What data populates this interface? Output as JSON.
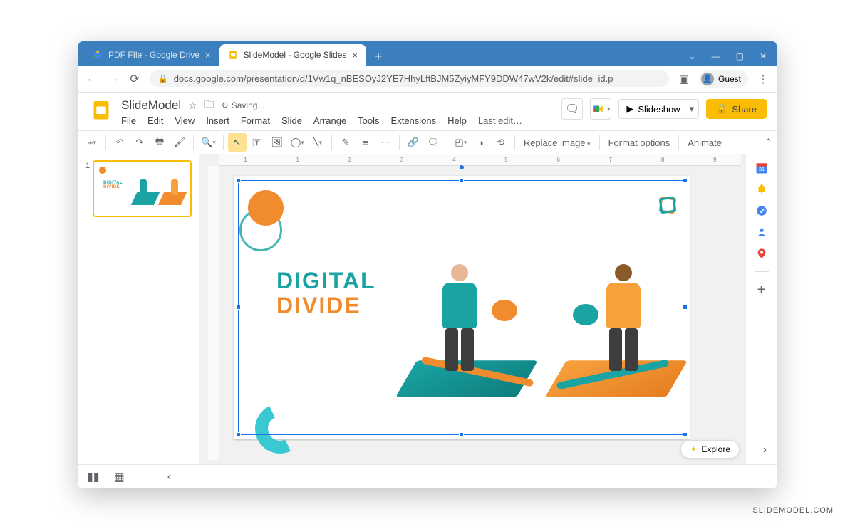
{
  "browser": {
    "tabs": [
      {
        "title": "PDF FIle - Google Drive",
        "active": false
      },
      {
        "title": "SlideModel - Google Slides",
        "active": true
      }
    ],
    "url": "docs.google.com/presentation/d/1Vw1q_nBESOyJ2YE7HhyLftBJM5ZyiyMFY9DDW47wV2k/edit#slide=id.p",
    "guest_label": "Guest"
  },
  "doc": {
    "title": "SlideModel",
    "saving": "Saving...",
    "last_edit": "Last edit…",
    "menus": [
      "File",
      "Edit",
      "View",
      "Insert",
      "Format",
      "Slide",
      "Arrange",
      "Tools",
      "Extensions",
      "Help"
    ],
    "slideshow": "Slideshow",
    "share": "Share"
  },
  "toolbar": {
    "replace_image": "Replace image",
    "format_options": "Format options",
    "animate": "Animate"
  },
  "ruler_marks": [
    "1",
    "1",
    "2",
    "3",
    "4",
    "5",
    "6",
    "7",
    "8",
    "9"
  ],
  "slide": {
    "number": "1",
    "title_line1": "DIGITAL",
    "title_line2": "DIVIDE"
  },
  "explore": "Explore",
  "watermark": "SLIDEMODEL.COM"
}
